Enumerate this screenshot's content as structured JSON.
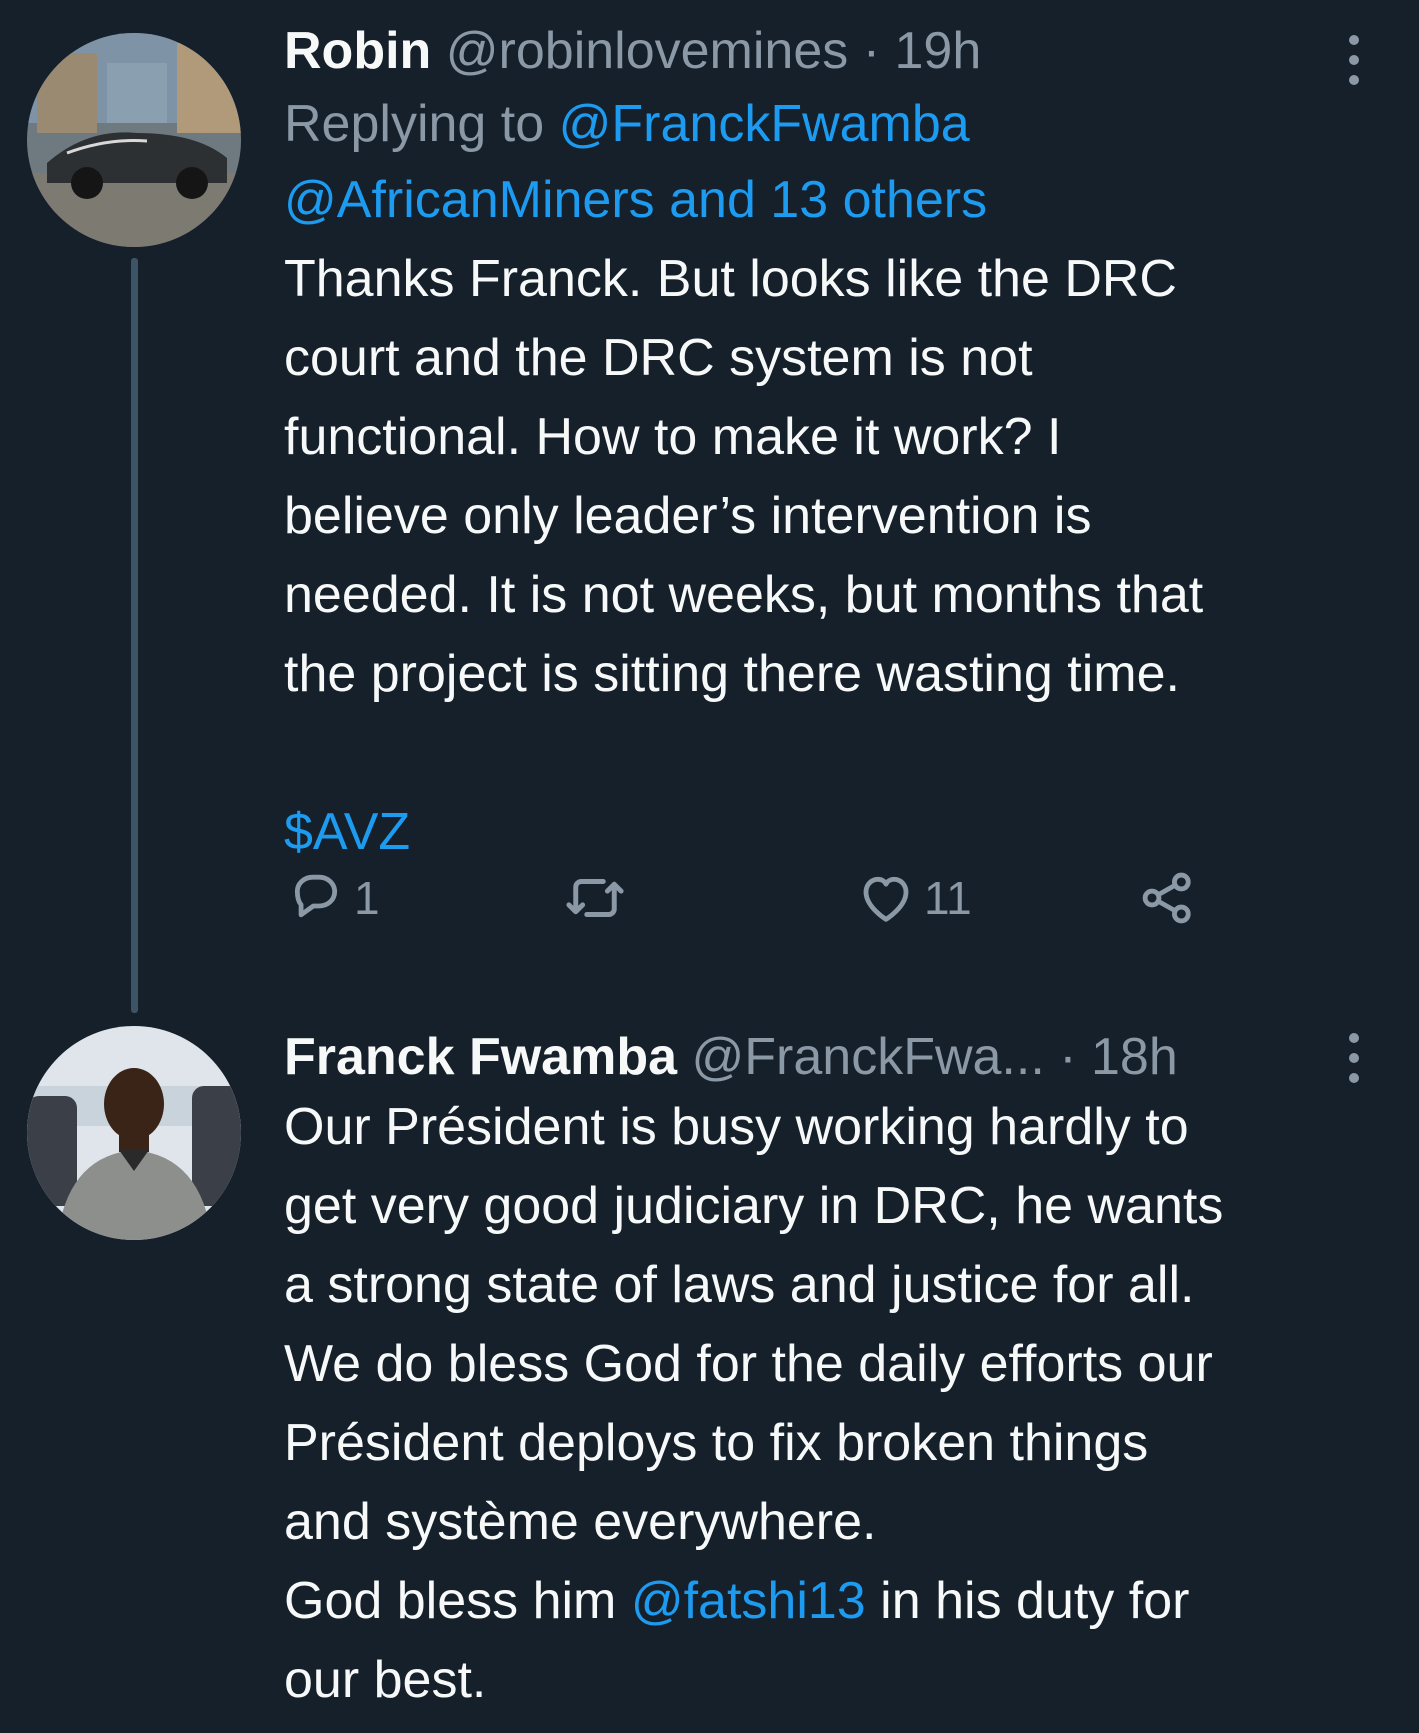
{
  "tweets": [
    {
      "display_name": "Robin",
      "handle": "@robinlovemines",
      "time_sep": " · ",
      "time": "19h",
      "replying_prefix": "Replying to ",
      "replying_to": "@FranckFwamba",
      "replying_more": "@AfricanMiners and 13 others",
      "text": "Thanks Franck. But looks like the DRC\ncourt and the DRC system is not\nfunctional. How to make it work? I\nbelieve only leader’s intervention is\nneeded. It is not weeks, but months that\nthe project is sitting there wasting time.",
      "cashtag": "$AVZ",
      "actions": {
        "reply_icon": "reply-icon",
        "reply_count": "1",
        "retweet_icon": "retweet-icon",
        "like_icon": "heart-icon",
        "like_count": "11",
        "share_icon": "share-icon"
      },
      "more_icon": "more-vertical-icon"
    },
    {
      "display_name": "Franck Fwamba",
      "handle": "@FranckFwa...",
      "time_sep": " · ",
      "time": "18h",
      "text": "Our Président is busy working hardly to\nget very good judiciary in DRC, he wants\na strong state of laws and justice for all.\nWe do bless God for the daily efforts our\nPrésident deploys to fix broken things\nand système everywhere.",
      "last_line_prefix": "God bless him ",
      "mention": "@fatshi13",
      "last_line_suffix": " in his duty for",
      "final_line": "our best.",
      "more_icon": "more-vertical-icon"
    }
  ],
  "colors": {
    "background": "#15202b",
    "primary_text": "#f7f9f9",
    "secondary_text": "#8b98a5",
    "link": "#1d9bf0",
    "thread_line": "#3d5466"
  }
}
